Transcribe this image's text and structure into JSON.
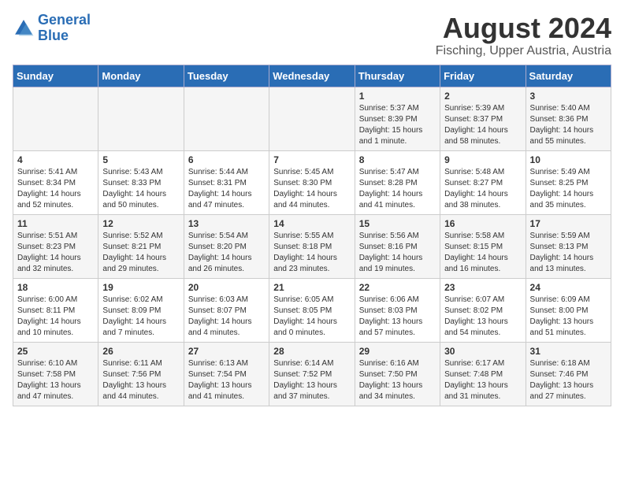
{
  "header": {
    "logo_line1": "General",
    "logo_line2": "Blue",
    "title": "August 2024",
    "subtitle": "Fisching, Upper Austria, Austria"
  },
  "calendar": {
    "days_of_week": [
      "Sunday",
      "Monday",
      "Tuesday",
      "Wednesday",
      "Thursday",
      "Friday",
      "Saturday"
    ],
    "weeks": [
      [
        {
          "day": "",
          "info": ""
        },
        {
          "day": "",
          "info": ""
        },
        {
          "day": "",
          "info": ""
        },
        {
          "day": "",
          "info": ""
        },
        {
          "day": "1",
          "info": "Sunrise: 5:37 AM\nSunset: 8:39 PM\nDaylight: 15 hours\nand 1 minute."
        },
        {
          "day": "2",
          "info": "Sunrise: 5:39 AM\nSunset: 8:37 PM\nDaylight: 14 hours\nand 58 minutes."
        },
        {
          "day": "3",
          "info": "Sunrise: 5:40 AM\nSunset: 8:36 PM\nDaylight: 14 hours\nand 55 minutes."
        }
      ],
      [
        {
          "day": "4",
          "info": "Sunrise: 5:41 AM\nSunset: 8:34 PM\nDaylight: 14 hours\nand 52 minutes."
        },
        {
          "day": "5",
          "info": "Sunrise: 5:43 AM\nSunset: 8:33 PM\nDaylight: 14 hours\nand 50 minutes."
        },
        {
          "day": "6",
          "info": "Sunrise: 5:44 AM\nSunset: 8:31 PM\nDaylight: 14 hours\nand 47 minutes."
        },
        {
          "day": "7",
          "info": "Sunrise: 5:45 AM\nSunset: 8:30 PM\nDaylight: 14 hours\nand 44 minutes."
        },
        {
          "day": "8",
          "info": "Sunrise: 5:47 AM\nSunset: 8:28 PM\nDaylight: 14 hours\nand 41 minutes."
        },
        {
          "day": "9",
          "info": "Sunrise: 5:48 AM\nSunset: 8:27 PM\nDaylight: 14 hours\nand 38 minutes."
        },
        {
          "day": "10",
          "info": "Sunrise: 5:49 AM\nSunset: 8:25 PM\nDaylight: 14 hours\nand 35 minutes."
        }
      ],
      [
        {
          "day": "11",
          "info": "Sunrise: 5:51 AM\nSunset: 8:23 PM\nDaylight: 14 hours\nand 32 minutes."
        },
        {
          "day": "12",
          "info": "Sunrise: 5:52 AM\nSunset: 8:21 PM\nDaylight: 14 hours\nand 29 minutes."
        },
        {
          "day": "13",
          "info": "Sunrise: 5:54 AM\nSunset: 8:20 PM\nDaylight: 14 hours\nand 26 minutes."
        },
        {
          "day": "14",
          "info": "Sunrise: 5:55 AM\nSunset: 8:18 PM\nDaylight: 14 hours\nand 23 minutes."
        },
        {
          "day": "15",
          "info": "Sunrise: 5:56 AM\nSunset: 8:16 PM\nDaylight: 14 hours\nand 19 minutes."
        },
        {
          "day": "16",
          "info": "Sunrise: 5:58 AM\nSunset: 8:15 PM\nDaylight: 14 hours\nand 16 minutes."
        },
        {
          "day": "17",
          "info": "Sunrise: 5:59 AM\nSunset: 8:13 PM\nDaylight: 14 hours\nand 13 minutes."
        }
      ],
      [
        {
          "day": "18",
          "info": "Sunrise: 6:00 AM\nSunset: 8:11 PM\nDaylight: 14 hours\nand 10 minutes."
        },
        {
          "day": "19",
          "info": "Sunrise: 6:02 AM\nSunset: 8:09 PM\nDaylight: 14 hours\nand 7 minutes."
        },
        {
          "day": "20",
          "info": "Sunrise: 6:03 AM\nSunset: 8:07 PM\nDaylight: 14 hours\nand 4 minutes."
        },
        {
          "day": "21",
          "info": "Sunrise: 6:05 AM\nSunset: 8:05 PM\nDaylight: 14 hours\nand 0 minutes."
        },
        {
          "day": "22",
          "info": "Sunrise: 6:06 AM\nSunset: 8:03 PM\nDaylight: 13 hours\nand 57 minutes."
        },
        {
          "day": "23",
          "info": "Sunrise: 6:07 AM\nSunset: 8:02 PM\nDaylight: 13 hours\nand 54 minutes."
        },
        {
          "day": "24",
          "info": "Sunrise: 6:09 AM\nSunset: 8:00 PM\nDaylight: 13 hours\nand 51 minutes."
        }
      ],
      [
        {
          "day": "25",
          "info": "Sunrise: 6:10 AM\nSunset: 7:58 PM\nDaylight: 13 hours\nand 47 minutes."
        },
        {
          "day": "26",
          "info": "Sunrise: 6:11 AM\nSunset: 7:56 PM\nDaylight: 13 hours\nand 44 minutes."
        },
        {
          "day": "27",
          "info": "Sunrise: 6:13 AM\nSunset: 7:54 PM\nDaylight: 13 hours\nand 41 minutes."
        },
        {
          "day": "28",
          "info": "Sunrise: 6:14 AM\nSunset: 7:52 PM\nDaylight: 13 hours\nand 37 minutes."
        },
        {
          "day": "29",
          "info": "Sunrise: 6:16 AM\nSunset: 7:50 PM\nDaylight: 13 hours\nand 34 minutes."
        },
        {
          "day": "30",
          "info": "Sunrise: 6:17 AM\nSunset: 7:48 PM\nDaylight: 13 hours\nand 31 minutes."
        },
        {
          "day": "31",
          "info": "Sunrise: 6:18 AM\nSunset: 7:46 PM\nDaylight: 13 hours\nand 27 minutes."
        }
      ]
    ]
  }
}
